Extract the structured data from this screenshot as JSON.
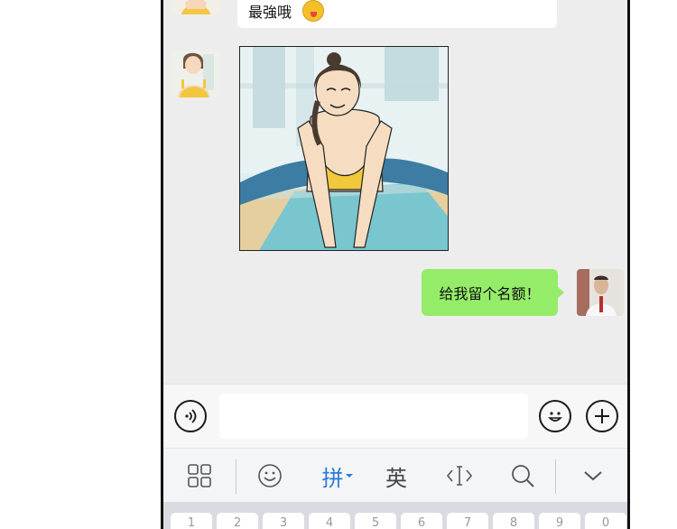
{
  "chat": {
    "messages": [
      {
        "side": "left",
        "type": "text",
        "text": "最強哦",
        "emoji": "tongue-face-emoji"
      },
      {
        "side": "left",
        "type": "image",
        "description": "comic panel"
      },
      {
        "side": "right",
        "type": "text",
        "text": "给我留个名额！"
      }
    ]
  },
  "input_bar": {
    "voice_icon": "voice-icon",
    "emoji_icon": "emoji-icon",
    "plus_icon": "plus-icon"
  },
  "ime_toolbar": {
    "items": [
      {
        "icon": "grid-icon"
      },
      {
        "icon": "smiley-icon"
      },
      {
        "label": "拼",
        "active": true
      },
      {
        "label": "英"
      },
      {
        "icon": "cursor-icon"
      },
      {
        "icon": "search-icon"
      },
      {
        "icon": "chevron-down-icon"
      }
    ]
  },
  "keyboard": {
    "number_row": [
      "1",
      "2",
      "3",
      "4",
      "5",
      "6",
      "7",
      "8",
      "9",
      "0"
    ]
  },
  "colors": {
    "chat_bg": "#ededed",
    "sent_bubble": "#95ec69",
    "ime_active": "#2b7bd8"
  }
}
